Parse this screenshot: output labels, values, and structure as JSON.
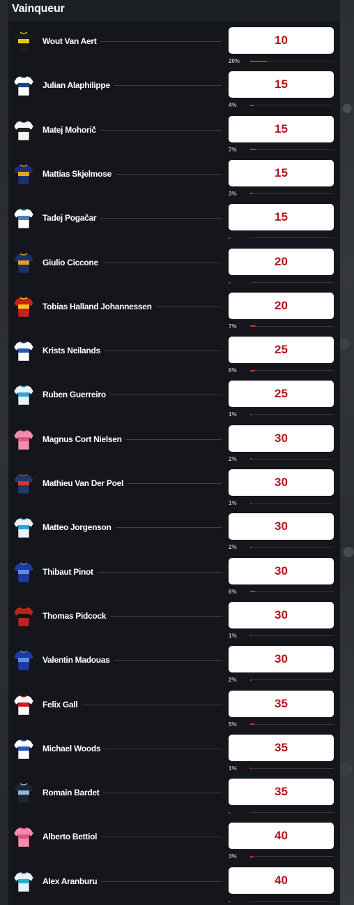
{
  "header": {
    "title": "Vainqueur"
  },
  "colors": {
    "odds_text": "#b3151c",
    "bar_fill": "#d42a26",
    "panel_bg": "#14161b"
  },
  "riders": [
    {
      "name": "Wout Van Aert",
      "odds": "10",
      "pct_label": "20%",
      "pct": 20,
      "jersey": {
        "icon": "jersey-jumbo-visma-icon",
        "body": "#1b1b1b",
        "accent": "#f2c418"
      }
    },
    {
      "name": "Julian Alaphilippe",
      "odds": "15",
      "pct_label": "4%",
      "pct": 4,
      "jersey": {
        "icon": "jersey-soudal-quickstep-icon",
        "body": "#ffffff",
        "accent": "#1c3f94"
      }
    },
    {
      "name": "Matej Mohorič",
      "odds": "15",
      "pct_label": "7%",
      "pct": 7,
      "jersey": {
        "icon": "jersey-bahrain-victorious-icon",
        "body": "#f4f4f4",
        "accent": "#222222"
      }
    },
    {
      "name": "Mattias Skjelmose",
      "odds": "15",
      "pct_label": "3%",
      "pct": 3,
      "jersey": {
        "icon": "jersey-lidl-trek-icon",
        "body": "#1e2f6e",
        "accent": "#e6a21a"
      }
    },
    {
      "name": "Tadej Pogačar",
      "odds": "15",
      "pct_label": "-",
      "pct": 0,
      "jersey": {
        "icon": "jersey-uae-emirates-icon",
        "body": "#ffffff",
        "accent": "#4a7fc4"
      }
    },
    {
      "name": "Giulio Ciccone",
      "odds": "20",
      "pct_label": "-",
      "pct": 0,
      "jersey": {
        "icon": "jersey-lidl-trek-icon",
        "body": "#1e2f6e",
        "accent": "#e6a21a"
      }
    },
    {
      "name": "Tobias Halland Johannessen",
      "odds": "20",
      "pct_label": "7%",
      "pct": 7,
      "jersey": {
        "icon": "jersey-uno-x-icon",
        "body": "#c4221b",
        "accent": "#f5c518"
      }
    },
    {
      "name": "Krists Neilands",
      "odds": "25",
      "pct_label": "6%",
      "pct": 6,
      "jersey": {
        "icon": "jersey-israel-premier-tech-icon",
        "body": "#ffffff",
        "accent": "#2a58b7"
      }
    },
    {
      "name": "Ruben Guerreiro",
      "odds": "25",
      "pct_label": "1%",
      "pct": 1,
      "jersey": {
        "icon": "jersey-movistar-icon",
        "body": "#e8f2f8",
        "accent": "#2aa5d8"
      }
    },
    {
      "name": "Magnus Cort Nielsen",
      "odds": "30",
      "pct_label": "2%",
      "pct": 2,
      "jersey": {
        "icon": "jersey-ef-education-icon",
        "body": "#ef8fb0",
        "accent": "#e0537f"
      }
    },
    {
      "name": "Mathieu Van Der Poel",
      "odds": "30",
      "pct_label": "1%",
      "pct": 1,
      "jersey": {
        "icon": "jersey-alpecin-icon",
        "body": "#1f3a68",
        "accent": "#d73531"
      }
    },
    {
      "name": "Matteo Jorgenson",
      "odds": "30",
      "pct_label": "2%",
      "pct": 2,
      "jersey": {
        "icon": "jersey-movistar-icon",
        "body": "#e8f2f8",
        "accent": "#2aa5d8"
      }
    },
    {
      "name": "Thibaut Pinot",
      "odds": "30",
      "pct_label": "6%",
      "pct": 6,
      "jersey": {
        "icon": "jersey-groupama-fdj-icon",
        "body": "#1d3aa0",
        "accent": "#5f8ee0"
      }
    },
    {
      "name": "Thomas Pidcock",
      "odds": "30",
      "pct_label": "1%",
      "pct": 1,
      "jersey": {
        "icon": "jersey-ineos-icon",
        "body": "#b8251c",
        "accent": "#121212"
      }
    },
    {
      "name": "Valentin Madouas",
      "odds": "30",
      "pct_label": "2%",
      "pct": 2,
      "jersey": {
        "icon": "jersey-groupama-fdj-icon",
        "body": "#1d3aa0",
        "accent": "#5f8ee0"
      }
    },
    {
      "name": "Felix Gall",
      "odds": "35",
      "pct_label": "5%",
      "pct": 5,
      "jersey": {
        "icon": "jersey-ag2r-icon",
        "body": "#ffffff",
        "accent": "#c3201e"
      }
    },
    {
      "name": "Michael Woods",
      "odds": "35",
      "pct_label": "1%",
      "pct": 1,
      "jersey": {
        "icon": "jersey-israel-premier-tech-icon",
        "body": "#ffffff",
        "accent": "#2a58b7"
      }
    },
    {
      "name": "Romain Bardet",
      "odds": "35",
      "pct_label": "-",
      "pct": 0,
      "jersey": {
        "icon": "jersey-dsm-icon",
        "body": "#1f2530",
        "accent": "#8fb8e8"
      }
    },
    {
      "name": "Alberto Bettiol",
      "odds": "40",
      "pct_label": "3%",
      "pct": 3,
      "jersey": {
        "icon": "jersey-ef-education-icon",
        "body": "#ef8fb0",
        "accent": "#e0537f"
      }
    },
    {
      "name": "Alex Aranburu",
      "odds": "40",
      "pct_label": "-",
      "pct": 0,
      "jersey": {
        "icon": "jersey-movistar-icon",
        "body": "#e8f2f8",
        "accent": "#2aa5d8"
      }
    }
  ]
}
